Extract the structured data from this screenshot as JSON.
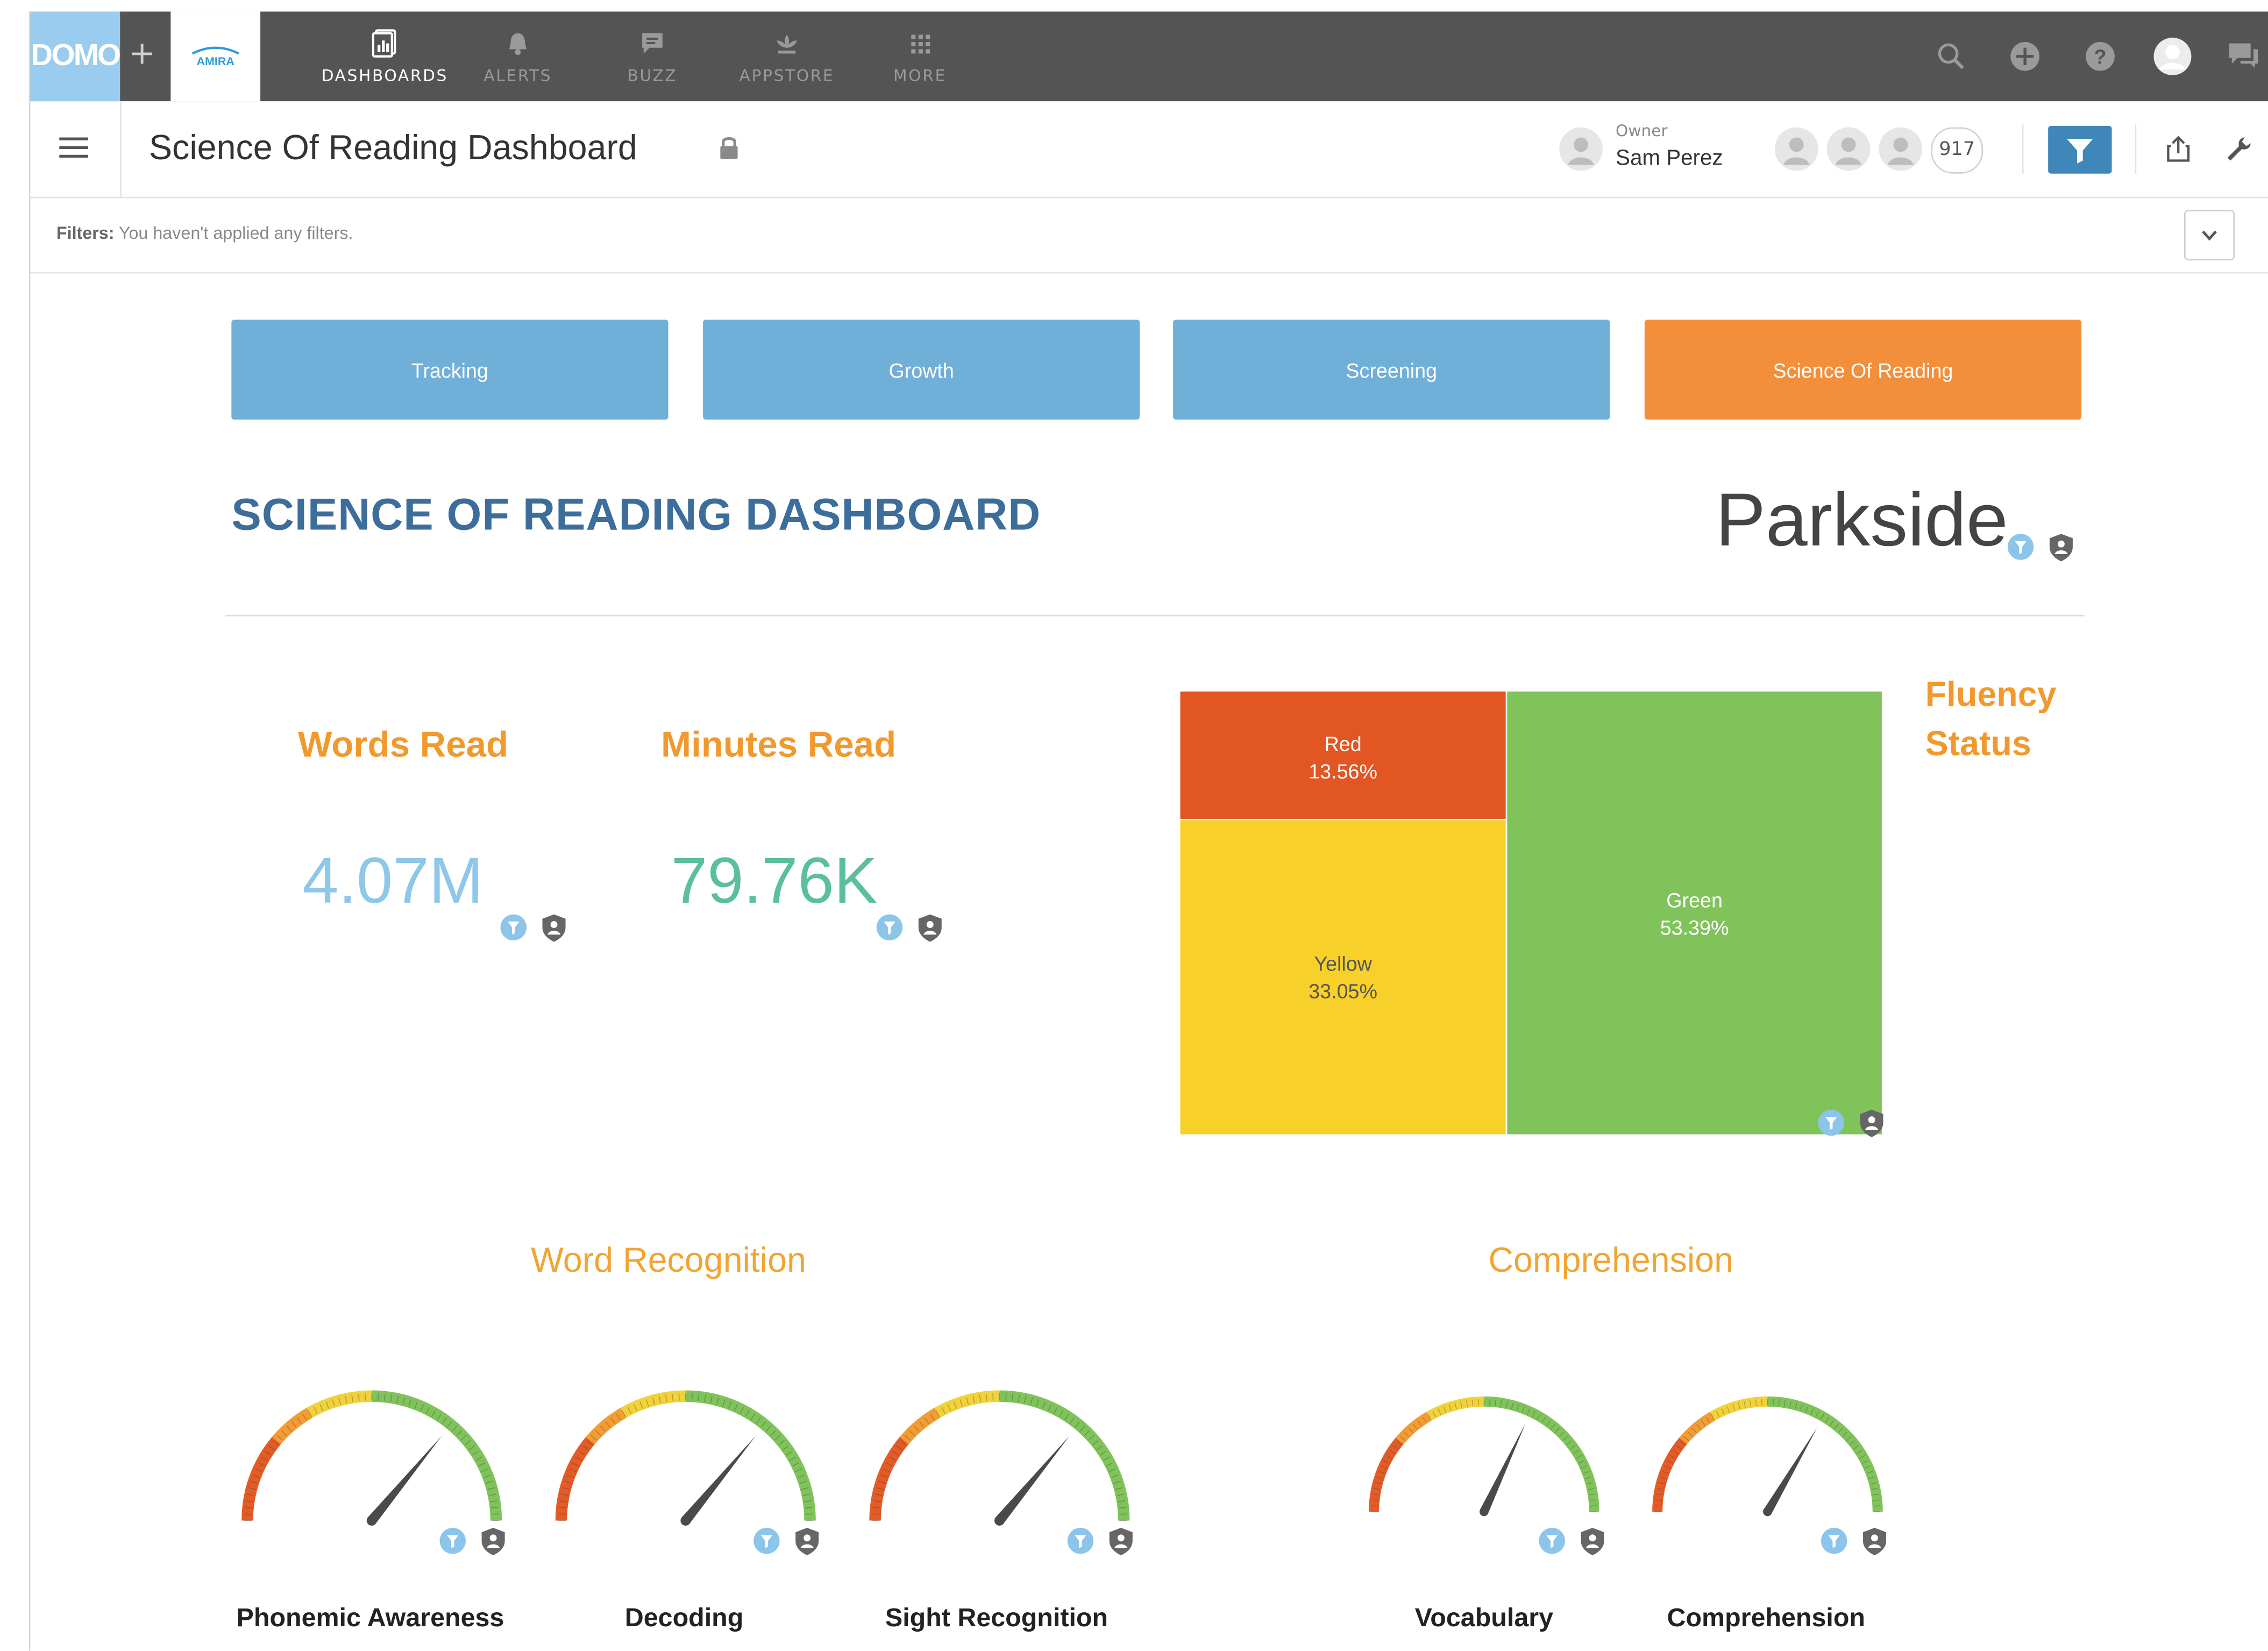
{
  "nav": {
    "logo": "DOMO",
    "plus": "+",
    "partner_logo": "AMIRA",
    "items": [
      {
        "label": "DASHBOARDS",
        "icon": "dashboards-icon"
      },
      {
        "label": "ALERTS",
        "icon": "bell-icon"
      },
      {
        "label": "BUZZ",
        "icon": "chat-icon"
      },
      {
        "label": "APPSTORE",
        "icon": "appstore-icon"
      },
      {
        "label": "MORE",
        "icon": "grid-icon"
      }
    ],
    "right_icons": [
      "search-icon",
      "add-icon",
      "help-icon",
      "profile-icon",
      "messages-icon"
    ]
  },
  "header": {
    "title": "Science Of Reading Dashboard",
    "owner_label": "Owner",
    "owner_name": "Sam Perez",
    "viewer_count": "917"
  },
  "filters": {
    "label": "Filters:",
    "text": "You haven't applied any filters."
  },
  "tabs": [
    {
      "label": "Tracking",
      "active": false
    },
    {
      "label": "Growth",
      "active": false
    },
    {
      "label": "Screening",
      "active": false
    },
    {
      "label": "Science Of Reading",
      "active": true
    }
  ],
  "dashboard": {
    "heading": "SCIENCE OF READING DASHBOARD",
    "school": "Parkside"
  },
  "metrics": [
    {
      "title": "Words Read",
      "value": "4.07M",
      "color": "#8ec7e8"
    },
    {
      "title": "Minutes Read",
      "value": "79.76K",
      "color": "#5bbf9b"
    }
  ],
  "fluency": {
    "title_line1": "Fluency",
    "title_line2": "Status",
    "chart_data": {
      "type": "treemap",
      "cells": [
        {
          "name": "Red",
          "value": "13.56%",
          "color": "#e15623"
        },
        {
          "name": "Yellow",
          "value": "33.05%",
          "color": "#f7d02a"
        },
        {
          "name": "Green",
          "value": "53.39%",
          "color": "#80c35b"
        }
      ]
    }
  },
  "sections": {
    "word_recognition": "Word Recognition",
    "comprehension": "Comprehension"
  },
  "gauges": [
    {
      "label": "Phonemic Awareness",
      "needle_fraction": 0.72
    },
    {
      "label": "Decoding",
      "needle_fraction": 0.72
    },
    {
      "label": "Sight Recognition",
      "needle_fraction": 0.72
    },
    {
      "label": "Vocabulary",
      "needle_fraction": 0.64
    },
    {
      "label": "Comprehension",
      "needle_fraction": 0.67
    }
  ],
  "colors": {
    "accent_blue": "#70afd8",
    "accent_orange": "#f38e3a",
    "nav_bg": "#545454",
    "heading_blue": "#3d6e9b"
  }
}
